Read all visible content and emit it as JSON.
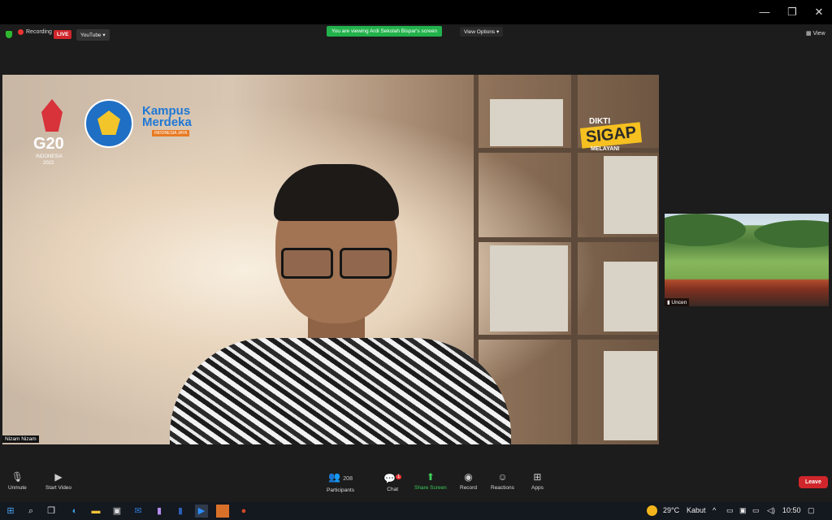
{
  "window": {
    "minimize_glyph": "—",
    "restore_glyph": "❐",
    "close_glyph": "✕"
  },
  "topbar": {
    "recording_label": "Recording",
    "live_label": "LIVE",
    "stream_target": "YouTube",
    "viewing_banner": "You are viewing Ardi Sekolah Bispar's screen",
    "view_options": "View Options",
    "view_button": "View"
  },
  "shared_screen": {
    "g20_text": "G20",
    "g20_sub": "INDONESIA",
    "g20_year": "2022",
    "kampus_line1": "Kampus",
    "kampus_line2": "Merdeka",
    "kampus_sub": "INDONESIA JAYA",
    "dikti": "DIKTI",
    "sigap": "SIGAP",
    "sigap_sub": "MELAYANI",
    "speaker_name": "Nizam Nizam"
  },
  "thumbnail": {
    "name": "Uncen"
  },
  "toolbar": {
    "unmute": "Unmute",
    "start_video": "Start Video",
    "participants": "Participants",
    "participants_count": "208",
    "chat": "Chat",
    "chat_badge": "1",
    "share_screen": "Share Screen",
    "record": "Record",
    "reactions": "Reactions",
    "apps": "Apps",
    "leave": "Leave"
  },
  "taskbar": {
    "temperature": "29°C",
    "weather": "Kabut",
    "time": "10:50"
  },
  "colors": {
    "live_red": "#d0262b",
    "share_green": "#22b24c",
    "sigap_yellow": "#f5c020"
  }
}
